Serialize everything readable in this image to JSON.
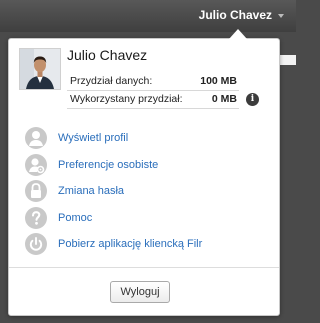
{
  "header": {
    "user_name": "Julio Chavez"
  },
  "user_card": {
    "name": "Julio Chavez",
    "quota": [
      {
        "label": "Przydział danych:",
        "value": "100 MB"
      },
      {
        "label": "Wykorzystany przydział:",
        "value": "0 MB"
      }
    ]
  },
  "menu": {
    "items": [
      {
        "label": "Wyświetl profil",
        "icon": "user-icon"
      },
      {
        "label": "Preferencje osobiste",
        "icon": "user-settings-icon"
      },
      {
        "label": "Zmiana hasła",
        "icon": "lock-icon"
      },
      {
        "label": "Pomoc",
        "icon": "help-icon"
      },
      {
        "label": "Pobierz aplikację kliencką Filr",
        "icon": "power-icon"
      }
    ]
  },
  "footer": {
    "logout_label": "Wyloguj"
  },
  "colors": {
    "link": "#2a6ebb",
    "icon_bg": "#c9c9c9",
    "topbar": "#4a4a4a"
  }
}
